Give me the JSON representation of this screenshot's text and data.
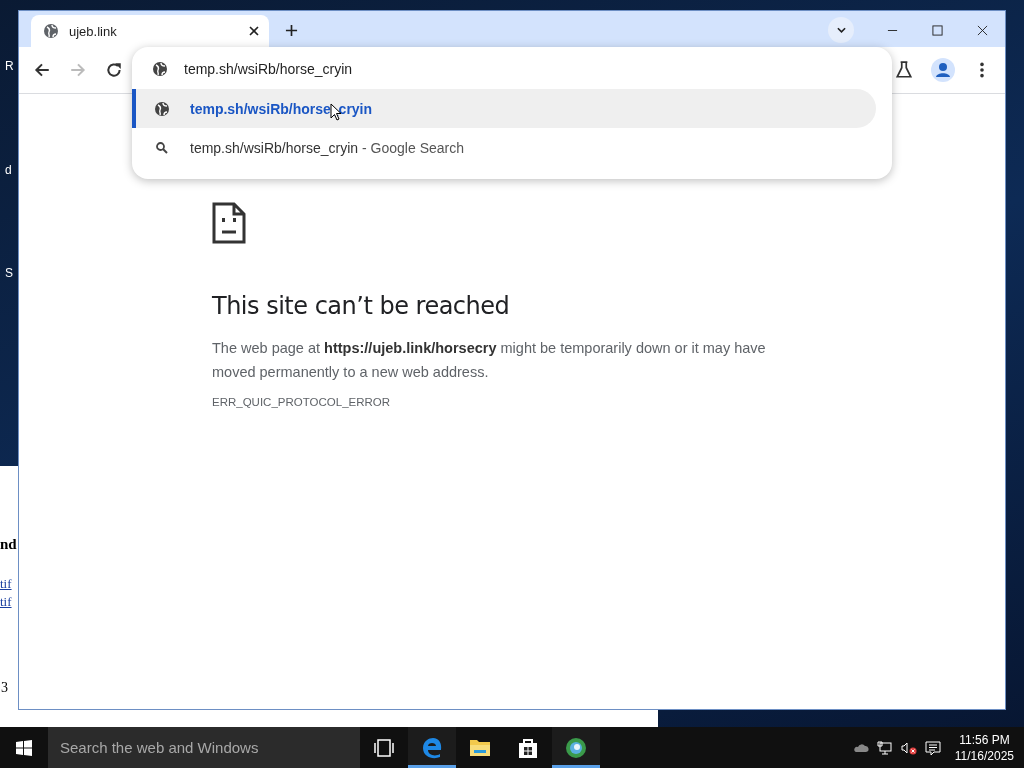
{
  "desktop": {
    "fragments": [
      "R",
      "d",
      "S"
    ]
  },
  "back_window": {
    "heading": "nd",
    "links": [
      "tif",
      "tif"
    ],
    "footer": "3"
  },
  "browser": {
    "tabs": [
      {
        "title": "ujeb.link",
        "selected": true
      }
    ],
    "omnibox": {
      "value": "temp.sh/wsiRb/horse_cryin"
    },
    "suggestions": [
      {
        "kind": "url",
        "text": "temp.sh/wsiRb/horse_cryin",
        "selected": true
      },
      {
        "kind": "search",
        "text": "temp.sh/wsiRb/horse_cryin",
        "suffix": "- Google Search",
        "selected": false
      }
    ]
  },
  "error_page": {
    "title": "This site can’t be reached",
    "message": "The web page at **https://ujeb.link/horsecry** might be temporarily down or it may have moved permanently to a new web address.",
    "code": "ERR_QUIC_PROTOCOL_ERROR"
  },
  "taskbar": {
    "search_placeholder": "Search the web and Windows",
    "apps": [
      {
        "kind": "task-view",
        "active": false
      },
      {
        "kind": "edge",
        "active": true
      },
      {
        "kind": "folder",
        "active": false
      },
      {
        "kind": "store",
        "active": false
      },
      {
        "kind": "globe",
        "active": true
      }
    ],
    "time": "11:56 PM",
    "date": "11/16/2025"
  }
}
